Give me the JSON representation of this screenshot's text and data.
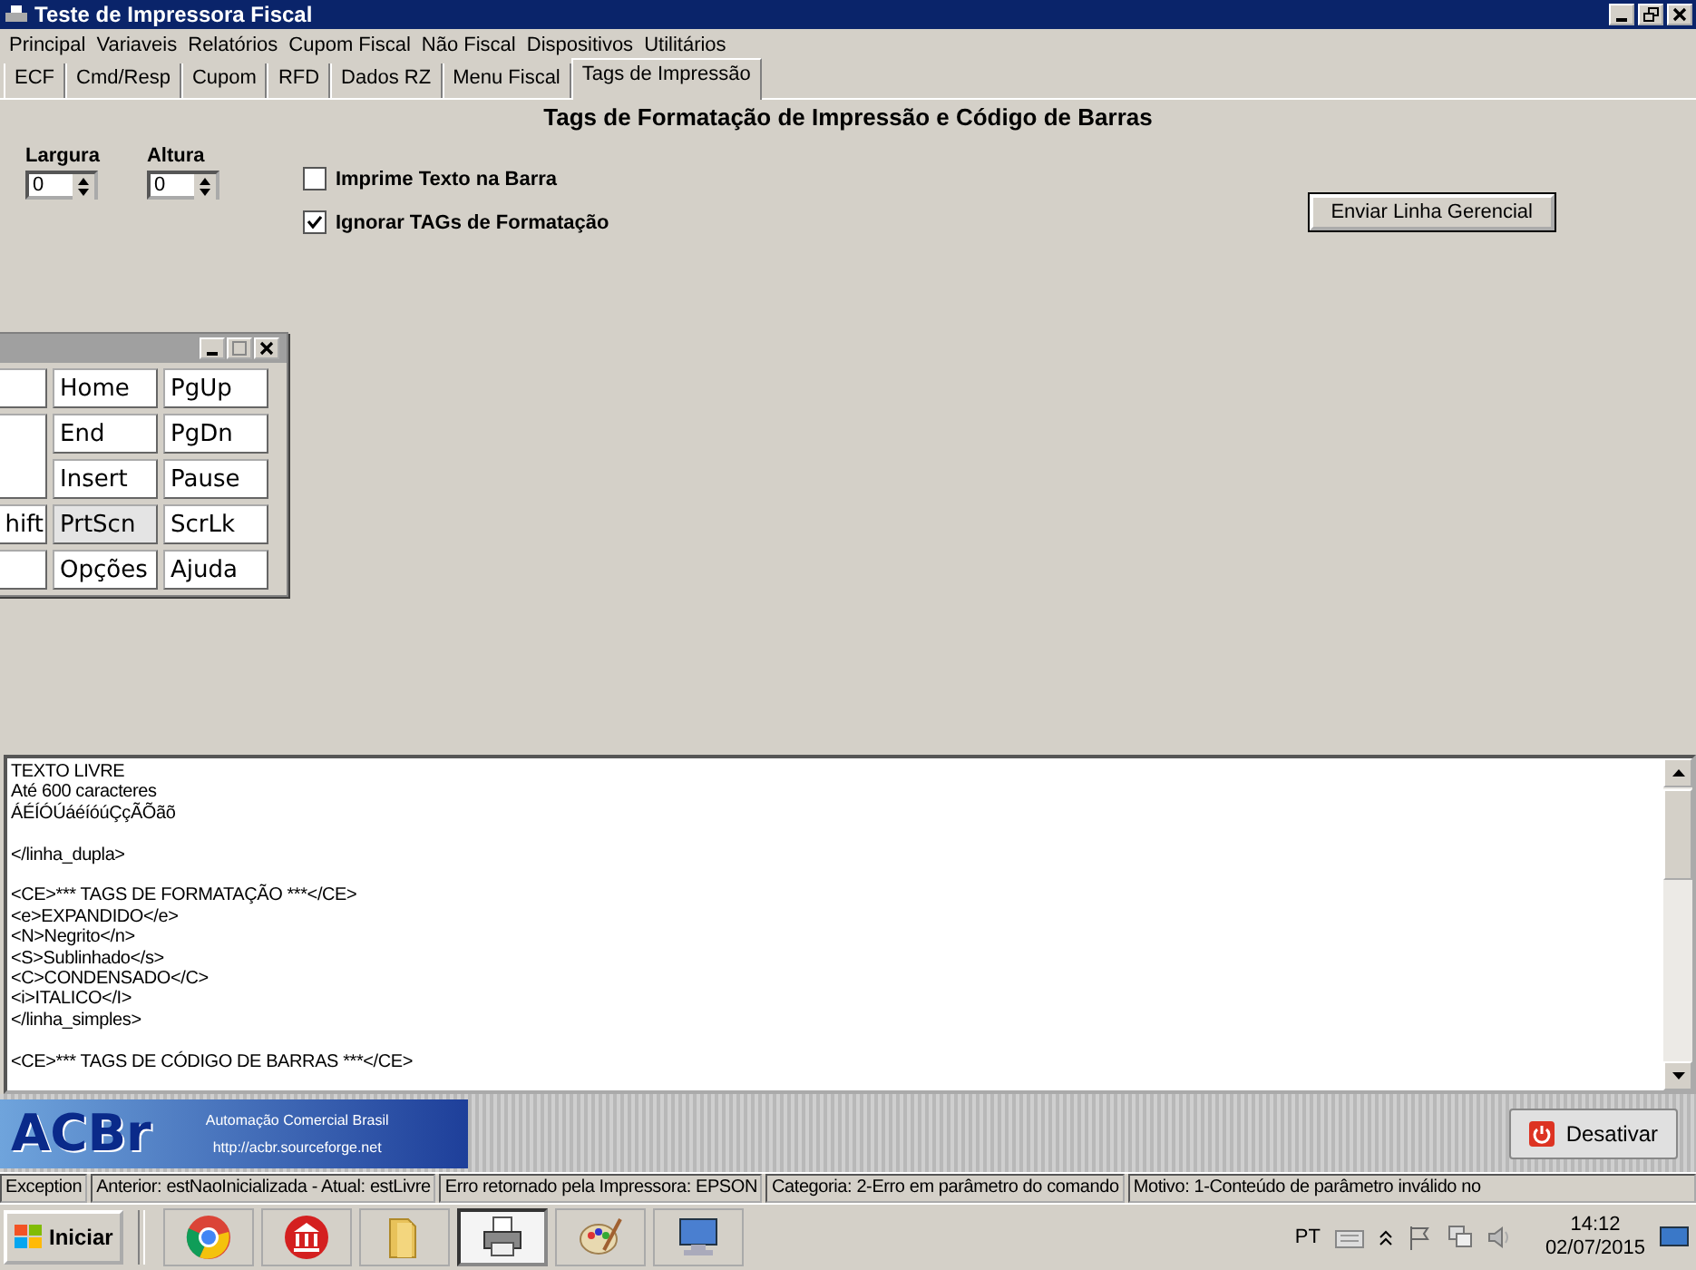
{
  "window": {
    "title": "Teste de Impressora Fiscal"
  },
  "menu": [
    "Principal",
    "Variaveis",
    "Relatórios",
    "Cupom Fiscal",
    "Não Fiscal",
    "Dispositivos",
    "Utilitários"
  ],
  "tabs": [
    {
      "label": "ECF",
      "selected": false
    },
    {
      "label": "Cmd/Resp",
      "selected": false
    },
    {
      "label": "Cupom",
      "selected": false
    },
    {
      "label": "RFD",
      "selected": false
    },
    {
      "label": "Dados RZ",
      "selected": false
    },
    {
      "label": "Menu Fiscal",
      "selected": false
    },
    {
      "label": "Tags de Impressão",
      "selected": true
    }
  ],
  "panel_title": "Tags de Formatação de Impressão e Código de Barras",
  "spinners": [
    {
      "label": "Largura",
      "value": "0"
    },
    {
      "label": "Altura",
      "value": "0"
    }
  ],
  "checkboxes": [
    {
      "label": "Imprime Texto na Barra",
      "checked": false
    },
    {
      "label": "Ignorar TAGs de Formatação",
      "checked": true
    }
  ],
  "send_button": "Enviar Linha Gerencial",
  "keyboard": {
    "keys": [
      {
        "kind": "key",
        "highlighted": false
      },
      {
        "label": "Home",
        "kind": "key",
        "highlighted": false
      },
      {
        "label": "PgUp",
        "kind": "key",
        "highlighted": false
      },
      {
        "kind": "tall",
        "highlighted": false
      },
      {
        "label": "End",
        "kind": "key",
        "highlighted": false
      },
      {
        "label": "PgDn",
        "kind": "key",
        "highlighted": false
      },
      {
        "label": "Insert",
        "kind": "key",
        "highlighted": false
      },
      {
        "label": "Pause",
        "kind": "key",
        "highlighted": false
      },
      {
        "label": "hift",
        "kind": "key",
        "highlighted": false
      },
      {
        "label": "PrtScn",
        "kind": "key",
        "highlighted": true
      },
      {
        "label": "ScrLk",
        "kind": "key",
        "highlighted": false
      },
      {
        "kind": "key",
        "highlighted": false
      },
      {
        "label": "Opções",
        "kind": "key",
        "highlighted": false
      },
      {
        "label": "Ajuda",
        "kind": "key",
        "highlighted": false
      }
    ]
  },
  "editor": {
    "paragraphs": [
      [
        "TEXTO LIVRE",
        "Até 600 caracteres",
        "ÁÉÍÓÚáéíóúÇçÃÕãõ"
      ],
      [
        "</linha_dupla>"
      ],
      [
        "<CE>*** TAGS DE FORMATAÇÃO ***</CE>",
        "<e>EXPANDIDO</e>",
        "<N>Negrito</n>",
        "<S>Sublinhado</s>",
        "<C>CONDENSADO</C>",
        "<i>ITALICO</I>",
        "</linha_simples>"
      ],
      [
        "<CE>*** TAGS DE CÓDIGO DE BARRAS ***</CE>"
      ]
    ]
  },
  "logo": {
    "text": "ACBr",
    "tagline": "Automação Comercial Brasil",
    "url": "http://acbr.sourceforge.net"
  },
  "deactivate_button": "Desativar",
  "status_bar": [
    "Exception",
    "Anterior: estNaoInicializada - Atual: estLivre",
    "Erro retornado pela Impressora: EPSON",
    "Categoria: 2-Erro em parâmetro do comando",
    "Motivo: 1-Conteúdo de parâmetro inválido no"
  ],
  "taskbar": {
    "start": "Iniciar",
    "apps": [
      {
        "kind": "browser",
        "active": false
      },
      {
        "kind": "bank",
        "active": false
      },
      {
        "kind": "folder",
        "active": false
      },
      {
        "kind": "printer",
        "active": true
      },
      {
        "kind": "paint",
        "active": false
      },
      {
        "kind": "computer",
        "active": false
      }
    ],
    "language": "PT",
    "time": "14:12",
    "date": "02/07/2015"
  }
}
